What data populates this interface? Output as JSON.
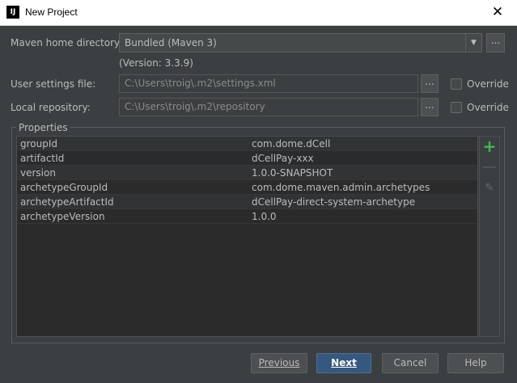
{
  "window": {
    "title": "New Project",
    "app_icon": "IJ"
  },
  "maven_home": {
    "label": "Maven home directory:",
    "value": "Bundled (Maven 3)",
    "version": "(Version: 3.3.9)"
  },
  "user_settings": {
    "label": "User settings file:",
    "value": "C:\\Users\\troig\\.m2\\settings.xml",
    "override": "Override"
  },
  "local_repo": {
    "label": "Local repository:",
    "value": "C:\\Users\\troig\\.m2\\repository",
    "override": "Override"
  },
  "properties": {
    "title": "Properties",
    "rows": [
      {
        "key": "groupId",
        "value": "com.dome.dCell"
      },
      {
        "key": "artifactId",
        "value": "dCellPay-xxx"
      },
      {
        "key": "version",
        "value": "1.0.0-SNAPSHOT"
      },
      {
        "key": "archetypeGroupId",
        "value": "com.dome.maven.admin.archetypes"
      },
      {
        "key": "archetypeArtifactId",
        "value": "dCellPay-direct-system-archetype"
      },
      {
        "key": "archetypeVersion",
        "value": "1.0.0"
      }
    ]
  },
  "buttons": {
    "previous": "Previous",
    "next": "Next",
    "cancel": "Cancel",
    "help": "Help",
    "browse": "..."
  },
  "colors": {
    "background": "#3c3f41",
    "accent": "#365880",
    "add": "#3fb950"
  }
}
